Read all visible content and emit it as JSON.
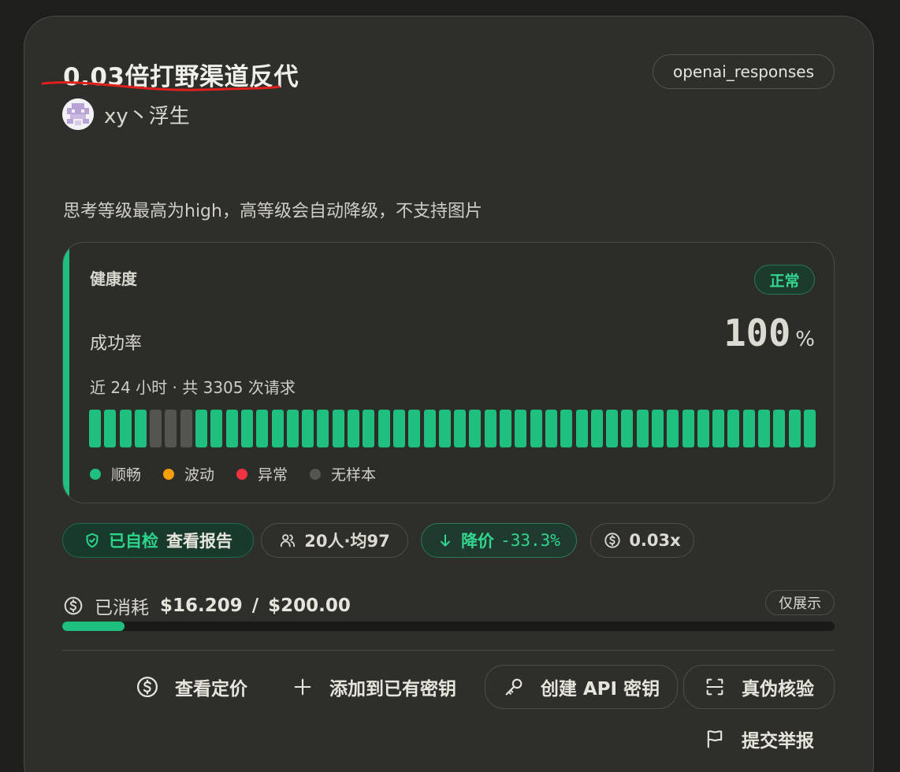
{
  "card": {
    "title": "0.03倍打野渠道反代",
    "tag": "openai_responses",
    "author": "xy丶浮生",
    "description": "思考等级最高为high，高等级会自动降级，不支持图片"
  },
  "health": {
    "label": "健康度",
    "status": "正常",
    "rate_label": "成功率",
    "rate_value": "100",
    "rate_unit": "%",
    "meta": "近 24 小时 · 共 3305 次请求",
    "bars": [
      "ok",
      "ok",
      "ok",
      "ok",
      "none",
      "none",
      "none",
      "ok",
      "ok",
      "ok",
      "ok",
      "ok",
      "ok",
      "ok",
      "ok",
      "ok",
      "ok",
      "ok",
      "ok",
      "ok",
      "ok",
      "ok",
      "ok",
      "ok",
      "ok",
      "ok",
      "ok",
      "ok",
      "ok",
      "ok",
      "ok",
      "ok",
      "ok",
      "ok",
      "ok",
      "ok",
      "ok",
      "ok",
      "ok",
      "ok",
      "ok",
      "ok",
      "ok",
      "ok",
      "ok",
      "ok",
      "ok",
      "ok"
    ],
    "legend": [
      {
        "label": "顺畅",
        "color": "#1fbf7f"
      },
      {
        "label": "波动",
        "color": "#f59e0b"
      },
      {
        "label": "异常",
        "color": "#ef3340"
      },
      {
        "label": "无样本",
        "color": "#55554f"
      }
    ],
    "colors": {
      "ok": "#1fbf7f",
      "warn": "#f59e0b",
      "bad": "#ef3340",
      "none": "#55554f"
    }
  },
  "chips": {
    "self_check": "已自检",
    "view_report": "查看报告",
    "users": "20人·均97",
    "price_down_label": "降价",
    "price_down_value": "-33.3%",
    "multiplier": "0.03x"
  },
  "spend": {
    "label": "已消耗",
    "used": "$16.209",
    "sep": "/",
    "total": "$200.00",
    "display_only": "仅展示",
    "fraction": 0.081
  },
  "actions": {
    "pricing": "查看定价",
    "add_key": "添加到已有密钥",
    "create_key": "创建 API 密钥",
    "verify": "真伪核验",
    "report": "提交举报"
  }
}
